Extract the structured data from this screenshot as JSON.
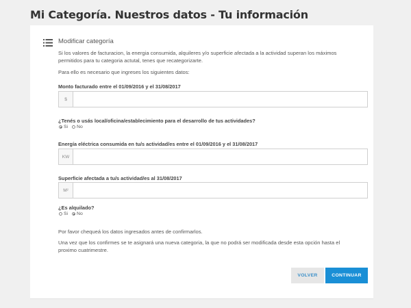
{
  "page": {
    "title": "Mi Categoría. Nuestros datos - Tu información"
  },
  "section": {
    "icon": "list-icon",
    "title": "Modificar categoría",
    "intro_line1": "Si los valores de facturacion, la energia consumida, alquileres y/o superficie afectada a la actividad superan los máximos",
    "intro_line2": "permitidos para tu categoria actutal, tenes que recategorizarte.",
    "intro_line3": "Para ello es necesario que ingreses los siguientes datos:"
  },
  "fields": {
    "monto": {
      "label": "Monto facturado entre el 01/09/2016 y el 31/08/2017",
      "addon": "$",
      "value": ""
    },
    "local": {
      "label": "¿Tenés o usás local/oficina/establecimiento para el desarrollo de tus actividades?",
      "opt_yes": "Si",
      "opt_no": "No",
      "selected": "Si"
    },
    "energia": {
      "label": "Energía eléctrica consumida en tu/s actividad/es entre el 01/09/2016 y el 31/08/2017",
      "addon": "KW",
      "value": ""
    },
    "superficie": {
      "label": "Superficie afectada a tu/s actividad/es al 31/08/2017",
      "addon": "M²",
      "value": ""
    },
    "alquilado": {
      "label": "¿Es alquilado?",
      "opt_yes": "Si",
      "opt_no": "No",
      "selected": "No"
    }
  },
  "footer": {
    "notice1": "Por favor chequeá los datos ingresados antes de confirmarlos.",
    "notice2_line1": "Una vez que los confirmes se te asignará una nueva categoria, la que no podrá ser modificada desde esta opción hasta el",
    "notice2_line2": "proximo cuatrimestre."
  },
  "buttons": {
    "back": "VOLVER",
    "continue": "CONTINUAR"
  }
}
